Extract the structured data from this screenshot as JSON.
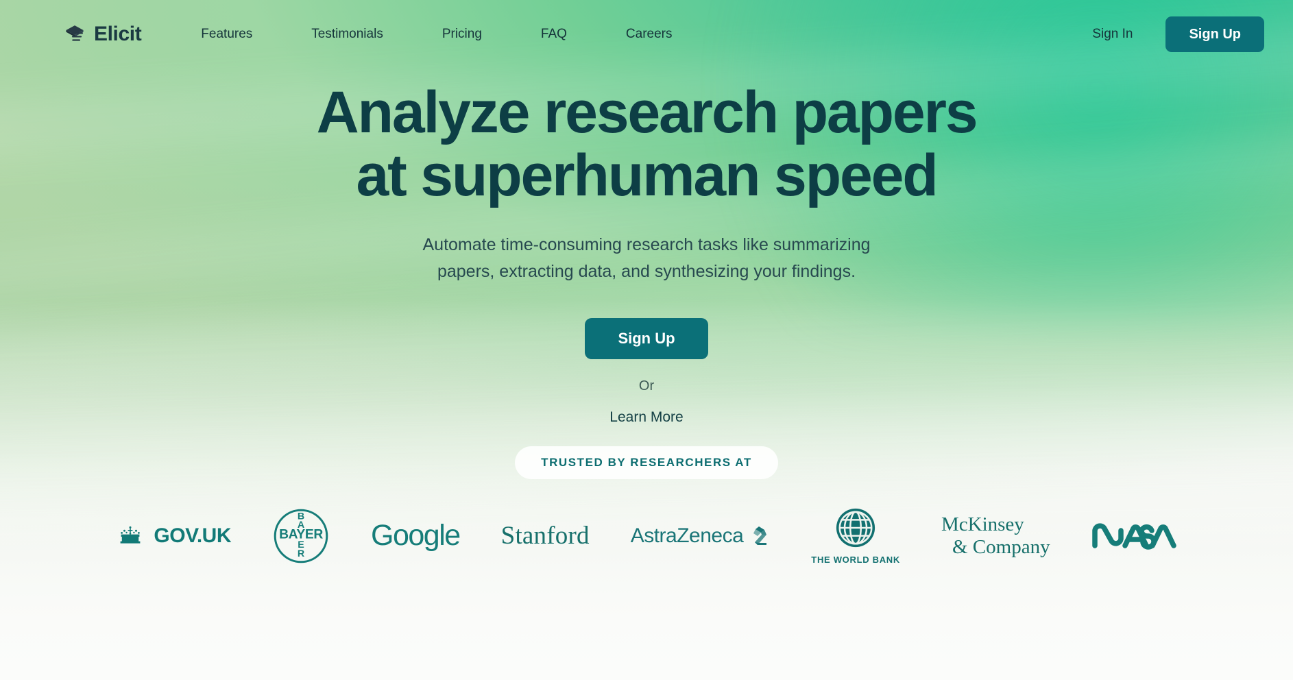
{
  "brand": {
    "name": "Elicit",
    "icon": "elicit-stacked-layers-icon"
  },
  "nav": {
    "items": [
      {
        "label": "Features"
      },
      {
        "label": "Testimonials"
      },
      {
        "label": "Pricing"
      },
      {
        "label": "FAQ"
      },
      {
        "label": "Careers"
      }
    ],
    "sign_in_label": "Sign In",
    "sign_up_label": "Sign Up"
  },
  "hero": {
    "headline_line1": "Analyze research papers",
    "headline_line2": "at superhuman speed",
    "subhead_line1": "Automate time-consuming research tasks like summarizing",
    "subhead_line2": "papers, extracting data, and synthesizing your findings.",
    "cta_label": "Sign Up",
    "or_label": "Or",
    "learn_more_label": "Learn More",
    "trusted_badge": "TRUSTED BY RESEARCHERS AT"
  },
  "logos": [
    {
      "id": "govuk",
      "text": "GOV.UK",
      "icon": "uk-crown-icon"
    },
    {
      "id": "bayer",
      "text": "BAYER",
      "icon": "bayer-cross-circle-icon"
    },
    {
      "id": "google",
      "text": "Google",
      "icon": ""
    },
    {
      "id": "stanford",
      "text": "Stanford",
      "icon": ""
    },
    {
      "id": "astrazeneca",
      "text": "AstraZeneca",
      "icon": "astrazeneca-ribbon-icon"
    },
    {
      "id": "worldbank",
      "text": "THE WORLD BANK",
      "icon": "globe-icon"
    },
    {
      "id": "mckinsey",
      "text_line1": "McKinsey",
      "text_line2": "& Company",
      "icon": ""
    },
    {
      "id": "nasa",
      "text": "NASA",
      "icon": "nasa-worm-icon"
    }
  ],
  "colors": {
    "brand_dark": "#1b3a42",
    "headline": "#0d3e45",
    "accent_teal": "#0b7078",
    "logo_teal": "#167d79",
    "bg_green_top_right": "#2fc79a",
    "bg_green_mid": "#a9d2a2",
    "bg_bottom": "#fbfcfa"
  }
}
